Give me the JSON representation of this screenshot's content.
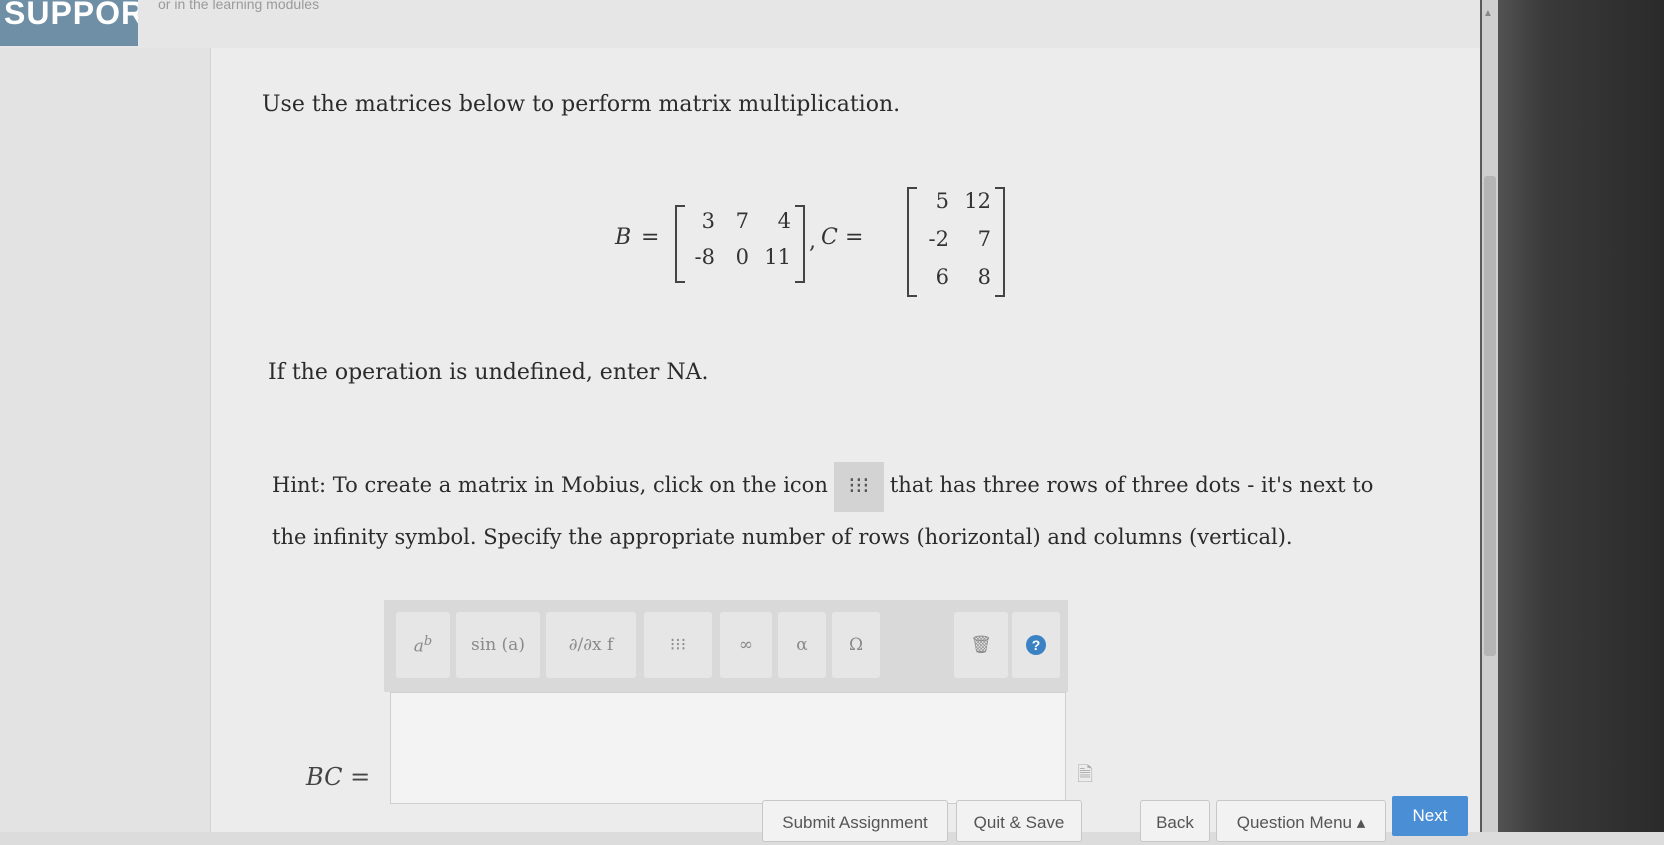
{
  "header": {
    "support_label": "SUPPORT",
    "top_note": "or in the learning modules"
  },
  "question": {
    "instruction": "Use the matrices below to perform matrix multiplication.",
    "matrix_B": {
      "name": "B",
      "rows": [
        [
          "3",
          "7",
          "4"
        ],
        [
          "-8",
          "0",
          "11"
        ]
      ]
    },
    "matrix_C": {
      "name": "C",
      "rows": [
        [
          "5",
          "12"
        ],
        [
          "-2",
          "7"
        ],
        [
          "6",
          "8"
        ]
      ]
    },
    "separator": ",",
    "equals": "=",
    "undefined_note": "If the operation is undefined, enter NA.",
    "hint_part1": "Hint: To create a matrix in Mobius, click on the icon",
    "hint_part2": "that has three rows of three dots - it's next to the infinity symbol. Specify the appropriate number of rows (horizontal) and columns (vertical).",
    "answer_label": "BC ="
  },
  "toolbar": {
    "buttons": [
      {
        "label": "a^b",
        "icon": "superscript-icon"
      },
      {
        "label": "sin (a)",
        "icon": "function-icon"
      },
      {
        "label": "∂/∂x f",
        "icon": "derivative-icon"
      },
      {
        "label": "⁝⁝⁝",
        "icon": "matrix-icon"
      },
      {
        "label": "∞",
        "icon": "infinity-icon"
      },
      {
        "label": "α",
        "icon": "greek-icon"
      },
      {
        "label": "Ω",
        "icon": "symbol-icon"
      },
      {
        "label": "🗑",
        "icon": "trash-icon"
      },
      {
        "label": "?",
        "icon": "help-icon"
      }
    ]
  },
  "footer": {
    "submit": "Submit Assignment",
    "quit": "Quit & Save",
    "back": "Back",
    "question_menu": "Question Menu ▴",
    "next": "Next"
  },
  "colors": {
    "next_button": "#4a8fd6",
    "support_bg": "#6f8fa6"
  }
}
